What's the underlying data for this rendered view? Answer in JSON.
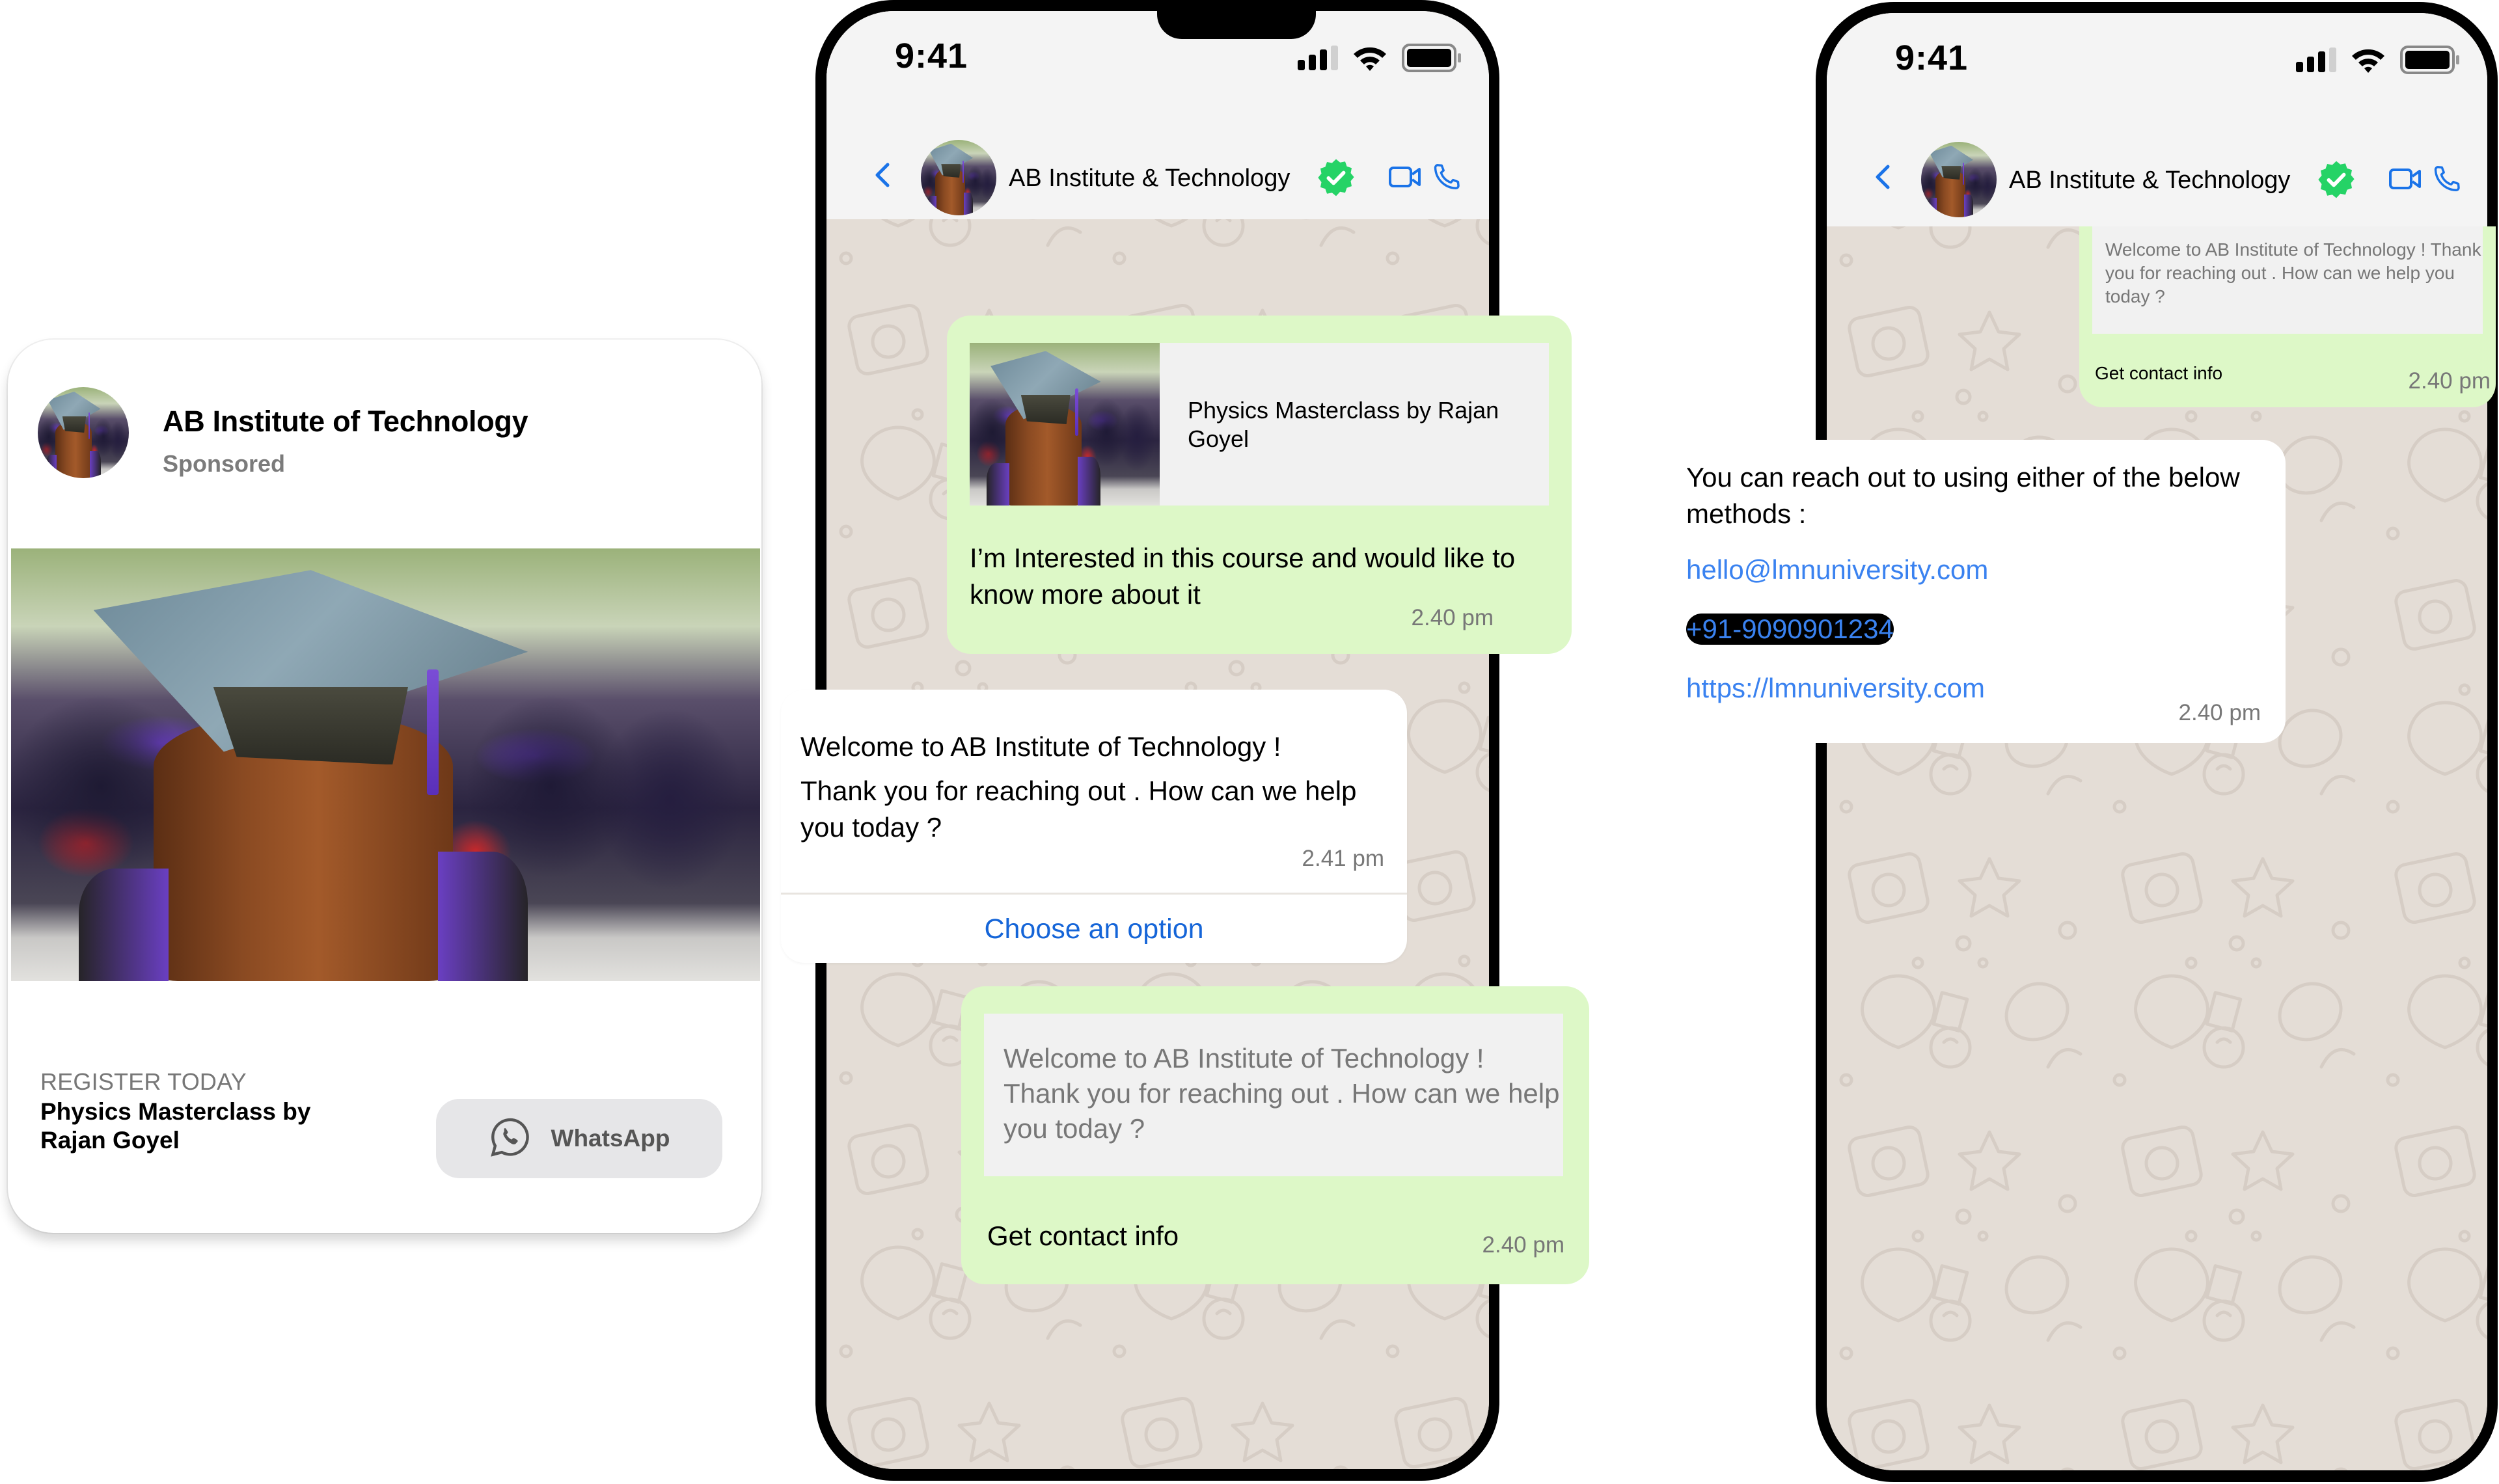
{
  "ad_card": {
    "page_name": "AB Institute of Technology",
    "sponsored_label": "Sponsored",
    "eyebrow": "REGISTER TODAY",
    "course_title": "Physics Masterclass by Rajan Goyel",
    "cta_label": "WhatsApp",
    "cta_icon": "whatsapp-icon"
  },
  "phone_middle": {
    "status_time": "9:41",
    "status_icons": [
      "signal-icon",
      "wifi-icon",
      "battery-icon"
    ],
    "header": {
      "back_icon": "chevron-left-icon",
      "title": "AB Institute & Technology",
      "verified_icon": "verified-badge-icon",
      "actions": [
        "video-call-icon",
        "phone-call-icon"
      ]
    },
    "messages": [
      {
        "type": "outgoing",
        "preview_title": "Physics Masterclass by Rajan Goyel",
        "text": "I’m Interested in this course and would like to know more about it",
        "time": "2.40 pm"
      },
      {
        "type": "incoming",
        "line1": "Welcome to AB Institute of Technology !",
        "line2": "Thank you for reaching out . How can we help you today ?",
        "time": "2.41 pm",
        "button_label": "Choose an option"
      },
      {
        "type": "outgoing",
        "quoted_text": "Welcome to AB Institute of Technology ! Thank you for reaching out . How can we help you today ?",
        "text": "Get contact info",
        "time": "2.40 pm"
      }
    ]
  },
  "phone_right": {
    "status_time": "9:41",
    "status_icons": [
      "signal-icon",
      "wifi-icon",
      "battery-icon"
    ],
    "header": {
      "back_icon": "chevron-left-icon",
      "title": "AB Institute & Technology",
      "verified_icon": "verified-badge-icon",
      "actions": [
        "video-call-icon",
        "phone-call-icon"
      ]
    },
    "messages": [
      {
        "type": "outgoing",
        "quoted_text": "Welcome to AB Institute of Technology ! Thank you for reaching out . How can we help you today ?",
        "text": "Get contact info",
        "time": "2.40 pm"
      },
      {
        "type": "incoming",
        "text": "You can reach out to using either of the below methods :",
        "email": "hello@lmnuniversity.com",
        "phone": "+91-9090901234",
        "url": "https://lmnuniversity.com",
        "time": "2.40 pm"
      }
    ]
  },
  "colors": {
    "outgoing_bubble": "#ddf8c7",
    "incoming_bubble": "#ffffff",
    "chat_wallpaper": "#e4ddd6",
    "header_bg": "#f4f4f4",
    "link_blue": "#3a82f0",
    "action_blue": "#1565d8",
    "verified_green": "#25d366"
  }
}
